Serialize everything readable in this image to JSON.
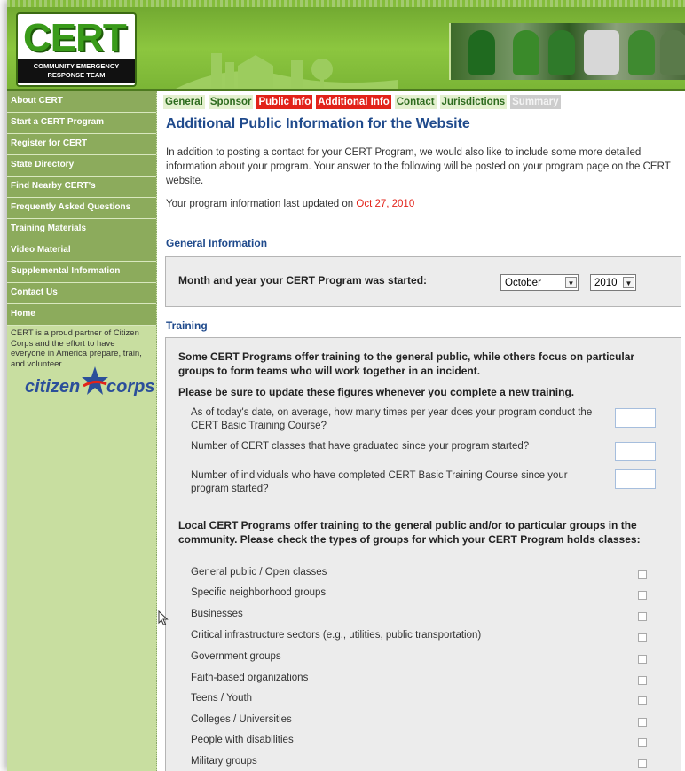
{
  "header": {
    "logo_text": "CERT",
    "logo_subtitle_1": "COMMUNITY EMERGENCY",
    "logo_subtitle_2": "RESPONSE TEAM"
  },
  "sidebar": {
    "items": [
      {
        "label": "About CERT"
      },
      {
        "label": "Start a CERT Program"
      },
      {
        "label": "Register for CERT"
      },
      {
        "label": "State Directory"
      },
      {
        "label": "Find Nearby CERT's"
      },
      {
        "label": "Frequently Asked Questions"
      },
      {
        "label": "Training Materials"
      },
      {
        "label": "Video Material"
      },
      {
        "label": "Supplemental Information"
      },
      {
        "label": "Contact Us"
      },
      {
        "label": "Home"
      }
    ],
    "blurb": "CERT is a proud partner of Citizen Corps and the effort to have everyone in America prepare, train, and volunteer.",
    "partner_logo_left": "citizen",
    "partner_logo_right": "corps"
  },
  "tabs": [
    {
      "label": "General",
      "style": "normal"
    },
    {
      "label": "Sponsor",
      "style": "normal"
    },
    {
      "label": "Public Info",
      "style": "active-red"
    },
    {
      "label": "Additional Info",
      "style": "active-red"
    },
    {
      "label": "Contact",
      "style": "normal"
    },
    {
      "label": "Jurisdictions",
      "style": "normal"
    },
    {
      "label": "Summary",
      "style": "disabled"
    }
  ],
  "page": {
    "title": "Additional Public Information for the Website",
    "intro": "In addition to posting a contact for your CERT Program, we would also like to include some more detailed information about your program. Your answer to the following will be posted on your program page on the CERT website.",
    "updated_prefix": "Your program information last updated on ",
    "updated_date": "Oct 27, 2010"
  },
  "general": {
    "heading": "General Information",
    "started_label": "Month and year your CERT Program was started:",
    "month_value": "October",
    "year_value": "2010"
  },
  "training": {
    "heading": "Training",
    "intro": "Some CERT Programs offer training to the general public, while others focus on particular groups to form teams who will work together in an incident.",
    "update_note": "Please be sure to update these figures whenever you complete a new training.",
    "questions": [
      "As of today's date, on average, how many times per year does your program conduct the CERT Basic Training Course?",
      "Number of CERT classes that have graduated since your program started?",
      "Number of individuals who have completed CERT Basic Training Course since your program started?"
    ],
    "groups_intro": "Local CERT Programs offer training to the general public and/or to particular groups in the community. Please check the types of groups for which your CERT Program holds classes:",
    "groups": [
      "General public / Open classes",
      "Specific neighborhood groups",
      "Businesses",
      "Critical infrastructure sectors (e.g., utilities, public transportation)",
      "Government groups",
      "Faith-based organizations",
      "Teens / Youth",
      "Colleges / Universities",
      "People with disabilities",
      "Military groups"
    ]
  },
  "colors": {
    "accent_red": "#e2231a",
    "heading_blue": "#1f4a8c",
    "nav_green": "#8cab5c"
  }
}
